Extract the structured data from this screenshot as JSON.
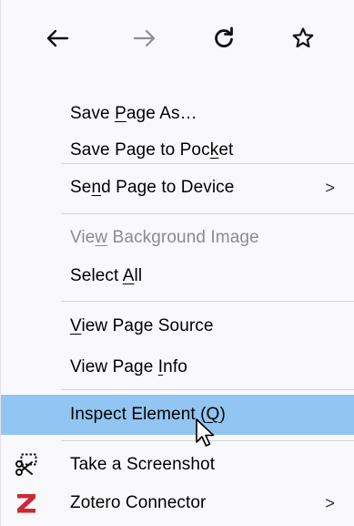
{
  "nav": {
    "back_icon": "back-arrow-icon",
    "forward_icon": "forward-arrow-icon",
    "reload_icon": "reload-icon",
    "bookmark_icon": "bookmark-star-icon"
  },
  "menu": {
    "items": [
      {
        "pre": "Save ",
        "key": "P",
        "post": "age As…",
        "disabled": false,
        "submenu": false
      },
      {
        "pre": "Save Page to Poc",
        "key": "k",
        "post": "et",
        "disabled": false,
        "submenu": false
      },
      {
        "pre": "Se",
        "key": "n",
        "post": "d Page to Device",
        "disabled": false,
        "submenu": true
      },
      {
        "pre": "Vie",
        "key": "w",
        "post": " Background Image",
        "disabled": true,
        "submenu": false
      },
      {
        "pre": "Select ",
        "key": "A",
        "post": "ll",
        "disabled": false,
        "submenu": false
      },
      {
        "pre": "",
        "key": "V",
        "post": "iew Page Source",
        "disabled": false,
        "submenu": false
      },
      {
        "pre": "View Page ",
        "key": "I",
        "post": "nfo",
        "disabled": false,
        "submenu": false
      },
      {
        "pre": "Inspect Element (",
        "key": "Q",
        "post": ")",
        "disabled": false,
        "submenu": false,
        "highlighted": true
      },
      {
        "pre": "Take a Screenshot",
        "key": "",
        "post": "",
        "disabled": false,
        "submenu": false,
        "icon": "screenshot-scissors-icon"
      },
      {
        "pre": "Zotero Connector",
        "key": "",
        "post": "",
        "disabled": false,
        "submenu": true,
        "icon": "zotero-icon"
      }
    ],
    "submenu_arrow": ">"
  },
  "colors": {
    "highlight": "#92c5f1",
    "disabled_text": "#8b8b8f",
    "zotero_red": "#cc2936",
    "forward_arrow": "#8e8e93"
  }
}
